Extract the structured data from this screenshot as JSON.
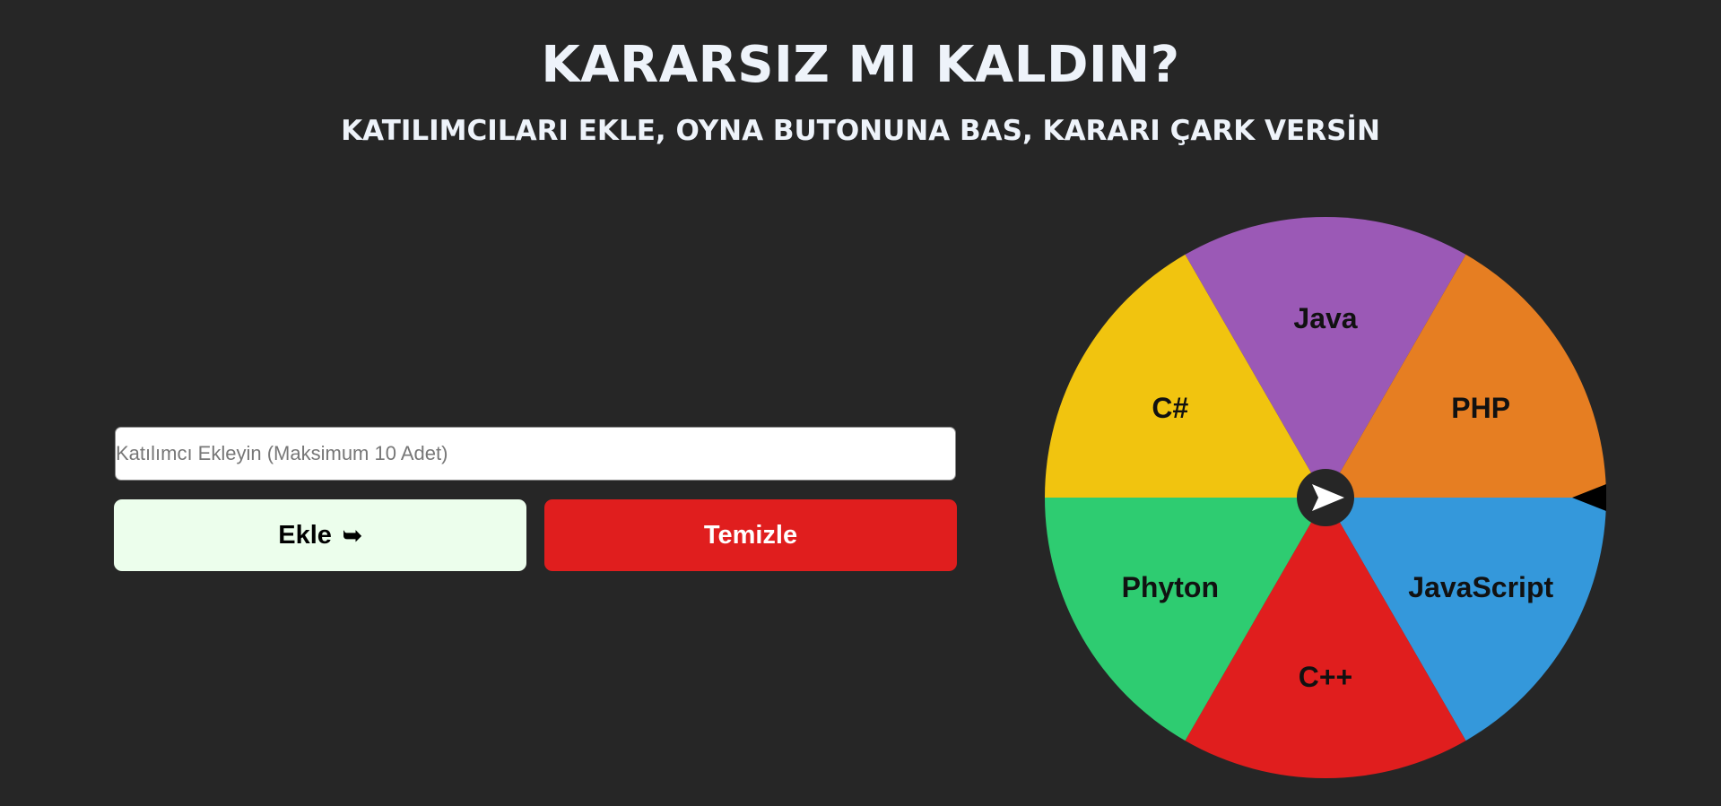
{
  "header": {
    "title": "KARARSIZ MI KALDIN?",
    "subtitle": "KATILIMCILARI EKLE, OYNA BUTONUNA BAS, KARARI ÇARK VERSİN"
  },
  "form": {
    "input_value": "",
    "input_placeholder": "Katılımcı Ekleyin (Maksimum 10 Adet)",
    "add_label": "Ekle",
    "add_icon": "arrow-right-icon",
    "clear_label": "Temizle"
  },
  "wheel": {
    "segments": [
      {
        "label": "JavaScript",
        "color": "#3498db"
      },
      {
        "label": "C++",
        "color": "#e01e1e"
      },
      {
        "label": "Phyton",
        "color": "#2ecc71"
      },
      {
        "label": "C#",
        "color": "#f1c40f"
      },
      {
        "label": "Java",
        "color": "#9b59b6"
      },
      {
        "label": "PHP",
        "color": "#e67e22"
      }
    ],
    "center_icon": "play-arrow-icon",
    "pointer_icon": "pointer-triangle-icon"
  },
  "colors": {
    "background": "#262626",
    "text": "#eef3fa",
    "add_button": "#ecfeec",
    "clear_button": "#e01e1e"
  }
}
